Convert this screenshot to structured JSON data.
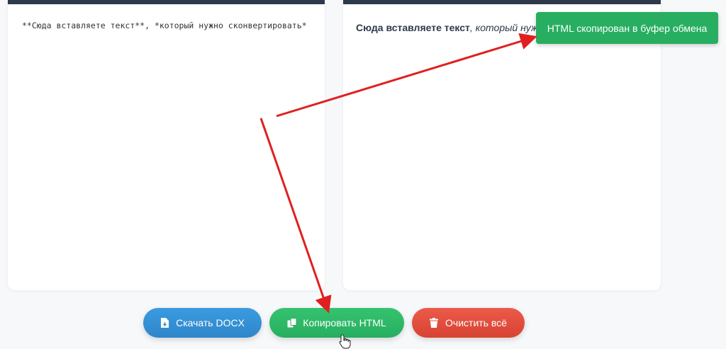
{
  "editor": {
    "content": "**Сюда вставляете текст**, *который нужно сконвертировать*"
  },
  "preview": {
    "bold_text": "Сюда вставляете текст",
    "italic_text": ", который нужно ск"
  },
  "toast": {
    "message": "HTML скопирован в буфер обмена"
  },
  "buttons": {
    "download_label": "Скачать DOCX",
    "copy_label": "Копировать HTML",
    "clear_label": "Очистить всё"
  },
  "colors": {
    "download": "#3a9be0",
    "copy": "#27ae60",
    "clear": "#d74333",
    "panel_header": "#2d3a4b",
    "arrow": "#e02020"
  },
  "icons": {
    "download": "file-download-icon",
    "copy": "copy-icon",
    "clear": "trash-icon"
  }
}
